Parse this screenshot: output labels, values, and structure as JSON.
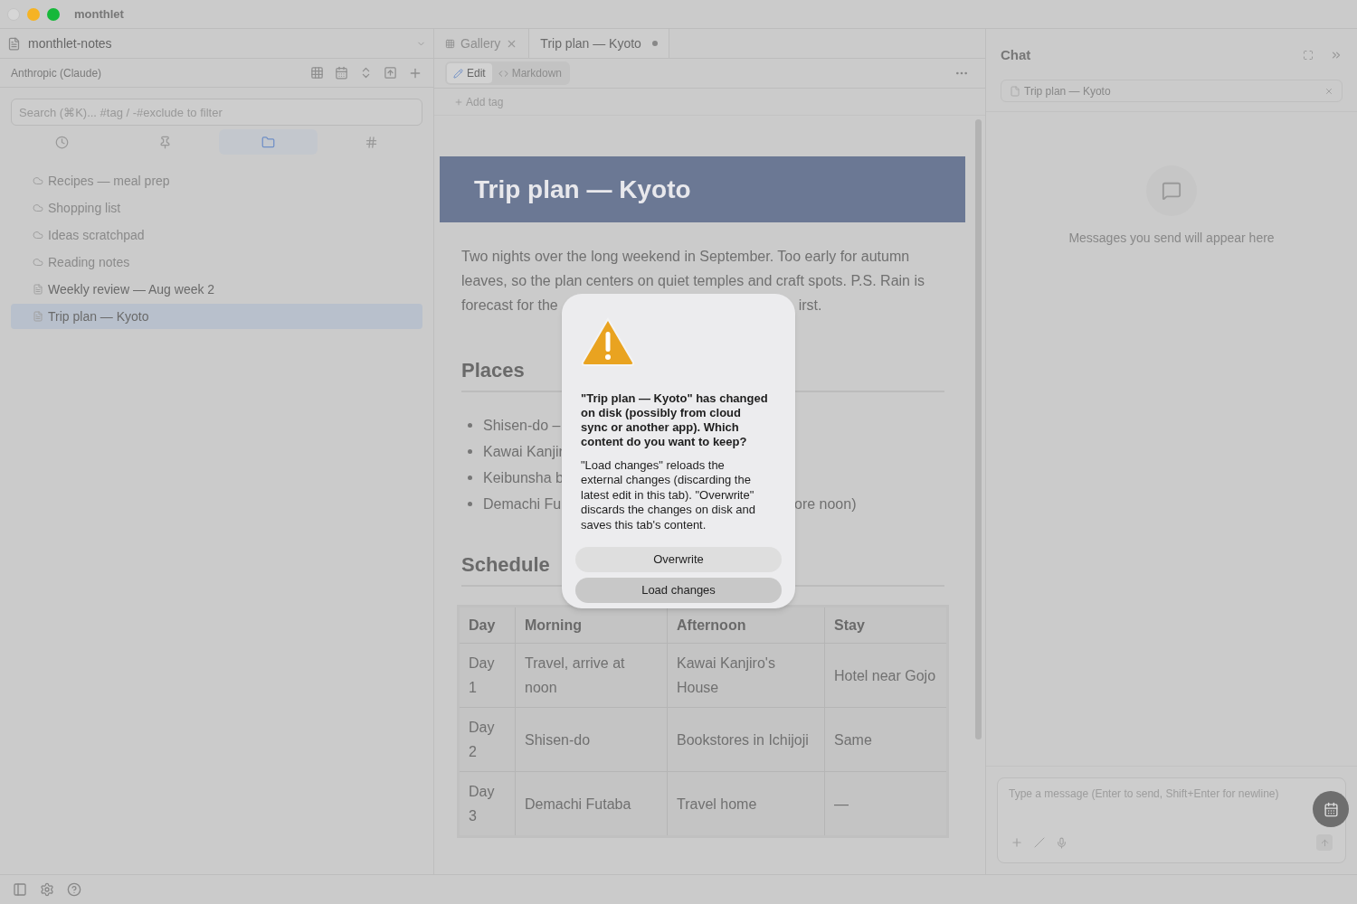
{
  "window": {
    "title": "monthlet"
  },
  "sidebar": {
    "vault": "monthlet-notes",
    "provider": "Anthropic (Claude)",
    "search": {
      "placeholder": "Search (⌘K)... #tag / -#exclude to filter"
    },
    "views": [
      {
        "kind": "recent",
        "selected": false
      },
      {
        "kind": "pinned",
        "selected": false
      },
      {
        "kind": "folders",
        "selected": true
      },
      {
        "kind": "tags",
        "selected": false
      }
    ],
    "notes": [
      {
        "title": "Recipes — meal prep",
        "kind": "cloud",
        "selected": false
      },
      {
        "title": "Shopping list",
        "kind": "cloud",
        "selected": false
      },
      {
        "title": "Ideas scratchpad",
        "kind": "cloud",
        "selected": false
      },
      {
        "title": "Reading notes",
        "kind": "cloud",
        "selected": false
      },
      {
        "title": "Weekly review — Aug week 2",
        "kind": "file",
        "selected": false
      },
      {
        "title": "Trip plan — Kyoto",
        "kind": "file",
        "selected": true
      }
    ]
  },
  "editor": {
    "tabs": [
      {
        "label": "Gallery",
        "kind": "gallery",
        "selected": false,
        "unsaved": false
      },
      {
        "label": "Trip plan — Kyoto",
        "kind": "note",
        "selected": true,
        "unsaved": true
      }
    ],
    "modes": [
      {
        "label": "Edit",
        "kind": "edit",
        "selected": true
      },
      {
        "label": "Markdown",
        "kind": "markdown",
        "selected": false
      }
    ],
    "add_tag": "Add tag",
    "title": "Trip plan — Kyoto",
    "paragraph": {
      "text": "Two nights over the long weekend in September. Too early for autumn leaves, so the plan centers on quiet temples and craft spots. P.S. Rain is forecast for the",
      "tail": "irst."
    },
    "places": {
      "heading": "Places",
      "bullets": [
        {
          "text": "Shisen-do –"
        },
        {
          "text": "Kawai Kanjir"
        },
        {
          "text": "Keibunsha b"
        },
        {
          "text": "Demachi Fu",
          "tail": "ore noon)"
        }
      ]
    },
    "schedule": {
      "heading": "Schedule",
      "columns": [
        "Day",
        "Morning",
        "Afternoon",
        "Stay"
      ],
      "rows": [
        [
          "Day 1",
          "Travel, arrive at noon",
          "Kawai Kanjiro's House",
          "Hotel near Gojo"
        ],
        [
          "Day 2",
          "Shisen-do",
          "Bookstores in Ichijoji",
          "Same"
        ],
        [
          "Day 3",
          "Demachi Futaba",
          "Travel home",
          "—"
        ]
      ]
    }
  },
  "chat": {
    "title": "Chat",
    "context": "Trip plan — Kyoto",
    "empty": "Messages you send will appear here",
    "composer": {
      "placeholder": "Type a message (Enter to send, Shift+Enter for newline)"
    }
  },
  "dialog": {
    "title": "\"Trip plan — Kyoto\" has changed on disk (possibly from cloud sync or another app). Which content do you want to keep?",
    "message": "\"Load changes\" reloads the external changes (discarding the latest edit in this tab). \"Overwrite\" discards the changes on disk and saves this tab's content.",
    "buttons": [
      {
        "label": "Overwrite",
        "kind": "secondary"
      },
      {
        "label": "Load changes",
        "kind": "default"
      }
    ]
  }
}
